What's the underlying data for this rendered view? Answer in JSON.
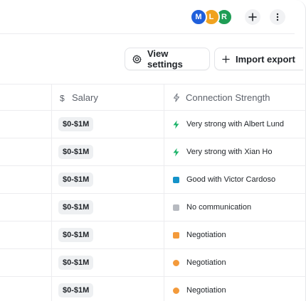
{
  "header": {
    "avatars": [
      {
        "initial": "M",
        "color": "#1f5fdb"
      },
      {
        "initial": "L",
        "color": "#f0a21f"
      },
      {
        "initial": "R",
        "color": "#1f9d55"
      }
    ]
  },
  "toolbar": {
    "view_settings_label": "View settings",
    "import_export_label": "Import export"
  },
  "table": {
    "columns": {
      "salary": "Salary",
      "connection": "Connection Strength"
    },
    "rows": [
      {
        "salary": "$0-$1M",
        "connection": "Very strong with Albert Lund",
        "marker": "bolt",
        "marker_color": "#1fb46b"
      },
      {
        "salary": "$0-$1M",
        "connection": "Very strong with Xian Ho",
        "marker": "bolt",
        "marker_color": "#1fb46b"
      },
      {
        "salary": "$0-$1M",
        "connection": "Good with Victor Cardoso",
        "marker": "square",
        "marker_color": "#1593c9"
      },
      {
        "salary": "$0-$1M",
        "connection": "No communication",
        "marker": "square",
        "marker_color": "#b7bac0"
      },
      {
        "salary": "$0-$1M",
        "connection": "Negotiation",
        "marker": "square",
        "marker_color": "#f39a3b"
      },
      {
        "salary": "$0-$1M",
        "connection": "Negotiation",
        "marker": "dot",
        "marker_color": "#f39a3b"
      },
      {
        "salary": "$0-$1M",
        "connection": "Negotiation",
        "marker": "dot",
        "marker_color": "#f39a3b"
      }
    ]
  }
}
